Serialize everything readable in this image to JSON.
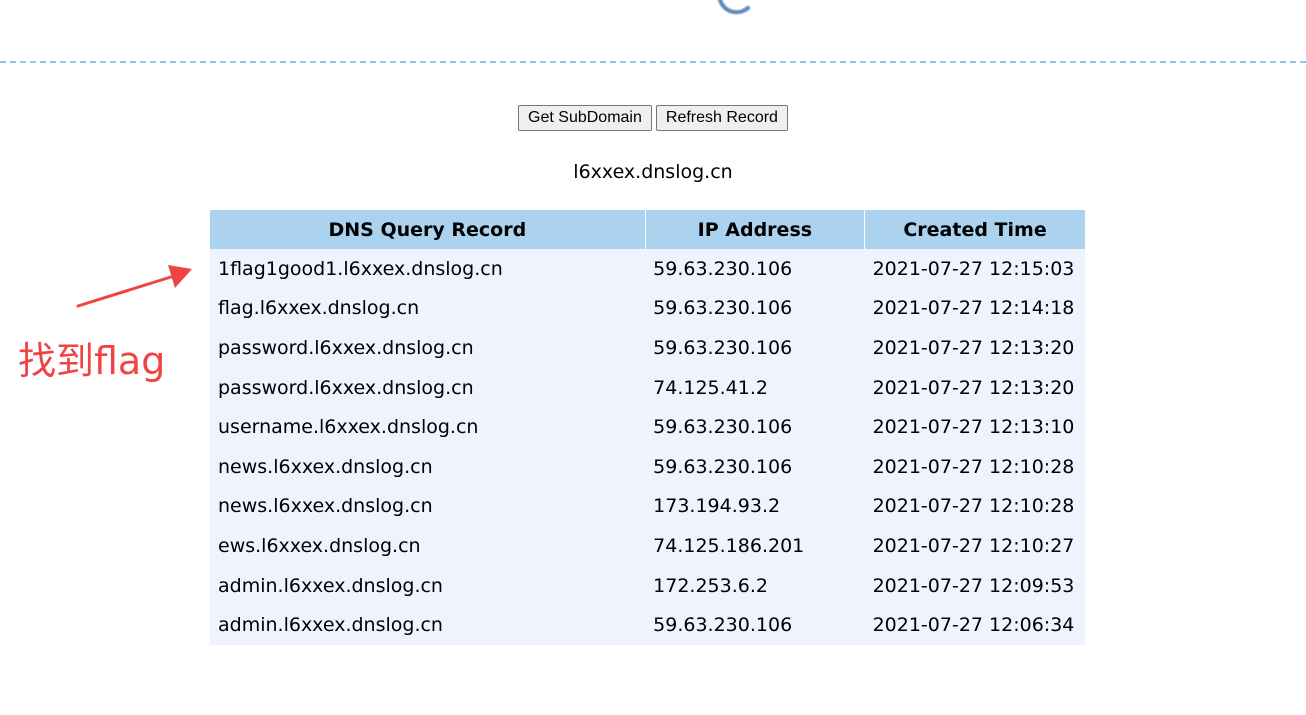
{
  "toolbar": {
    "get_subdomain_label": "Get SubDomain",
    "refresh_record_label": "Refresh Record"
  },
  "subdomain": "l6xxex.dnslog.cn",
  "table": {
    "headers": [
      "DNS Query Record",
      "IP Address",
      "Created Time"
    ],
    "rows": [
      {
        "record": "1flag1good1.l6xxex.dnslog.cn",
        "ip": "59.63.230.106",
        "time": "2021-07-27 12:15:03"
      },
      {
        "record": "flag.l6xxex.dnslog.cn",
        "ip": "59.63.230.106",
        "time": "2021-07-27 12:14:18"
      },
      {
        "record": "password.l6xxex.dnslog.cn",
        "ip": "59.63.230.106",
        "time": "2021-07-27 12:13:20"
      },
      {
        "record": "password.l6xxex.dnslog.cn",
        "ip": "74.125.41.2",
        "time": "2021-07-27 12:13:20"
      },
      {
        "record": "username.l6xxex.dnslog.cn",
        "ip": "59.63.230.106",
        "time": "2021-07-27 12:13:10"
      },
      {
        "record": "news.l6xxex.dnslog.cn",
        "ip": "59.63.230.106",
        "time": "2021-07-27 12:10:28"
      },
      {
        "record": "news.l6xxex.dnslog.cn",
        "ip": "173.194.93.2",
        "time": "2021-07-27 12:10:28"
      },
      {
        "record": "ews.l6xxex.dnslog.cn",
        "ip": "74.125.186.201",
        "time": "2021-07-27 12:10:27"
      },
      {
        "record": "admin.l6xxex.dnslog.cn",
        "ip": "172.253.6.2",
        "time": "2021-07-27 12:09:53"
      },
      {
        "record": "admin.l6xxex.dnslog.cn",
        "ip": "59.63.230.106",
        "time": "2021-07-27 12:06:34"
      }
    ]
  },
  "annotation": {
    "text": "找到flag",
    "color": "#ef4444"
  },
  "colors": {
    "header_bg": "#abd3ef",
    "row_bg": "#eef3fd",
    "divider": "#8ecbe8"
  },
  "icons": {
    "logo": "logo-fragment-icon",
    "annotation_arrow": "red-arrow-icon"
  }
}
